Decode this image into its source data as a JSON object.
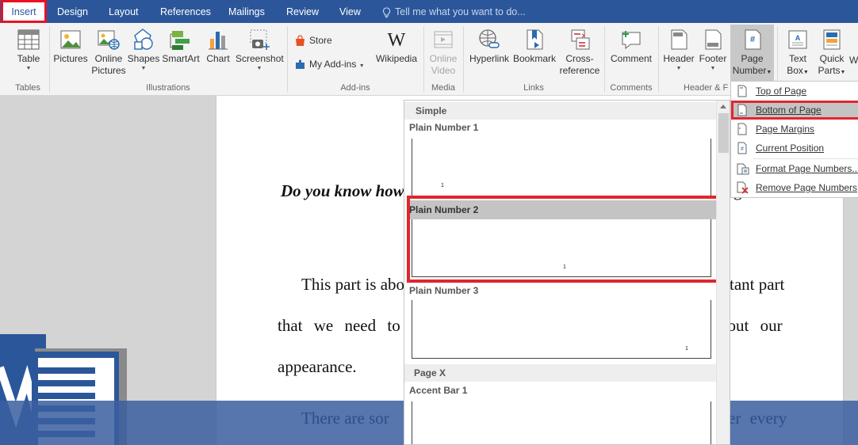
{
  "tabs": [
    "Insert",
    "Design",
    "Layout",
    "References",
    "Mailings",
    "Review",
    "View"
  ],
  "tell_me": "Tell me what you want to do...",
  "ribbon": {
    "groups": {
      "tables": "Tables",
      "illustrations": "Illustrations",
      "addins": "Add-ins",
      "media": "Media",
      "links": "Links",
      "comments": "Comments",
      "header_footer": "Header & F"
    },
    "table": "Table",
    "pictures": "Pictures",
    "online_pictures": [
      "Online",
      "Pictures"
    ],
    "shapes": "Shapes",
    "smartart": "SmartArt",
    "chart": "Chart",
    "screenshot": "Screenshot",
    "store": "Store",
    "my_addins": "My Add-ins",
    "wikipedia": "Wikipedia",
    "online_video": [
      "Online",
      "Video"
    ],
    "hyperlink": "Hyperlink",
    "bookmark": "Bookmark",
    "cross_reference": [
      "Cross-",
      "reference"
    ],
    "comment": "Comment",
    "header": "Header",
    "footer": "Footer",
    "page_number": [
      "Page",
      "Number"
    ],
    "text_box": [
      "Text",
      "Box"
    ],
    "quick_parts": [
      "Quick",
      "Parts"
    ],
    "overflow": "W"
  },
  "document": {
    "heading": "Do you know how",
    "heading_tail": "g",
    "line1_left": "This part is abo",
    "line1_right": "rtant part",
    "line2_left": "that we need to",
    "line2_right": "bout our",
    "line3": "appearance.",
    "line4_left": "There are sor",
    "line4_right": "er every"
  },
  "gallery": {
    "section_simple": "Simple",
    "plain1": "Plain Number 1",
    "plain2": "Plain Number 2",
    "plain3": "Plain Number 3",
    "section_pagex": "Page X",
    "accent1": "Accent Bar 1",
    "sample_number": "1"
  },
  "page_number_menu": {
    "top": "Top of Page",
    "bottom": "Bottom of Page",
    "margins": "Page Margins",
    "current": "Current Position",
    "format": "Format Page Numbers...",
    "remove": "Remove Page Numbers"
  },
  "colors": {
    "word_blue": "#2b579a",
    "highlight_red": "#e0262f"
  }
}
